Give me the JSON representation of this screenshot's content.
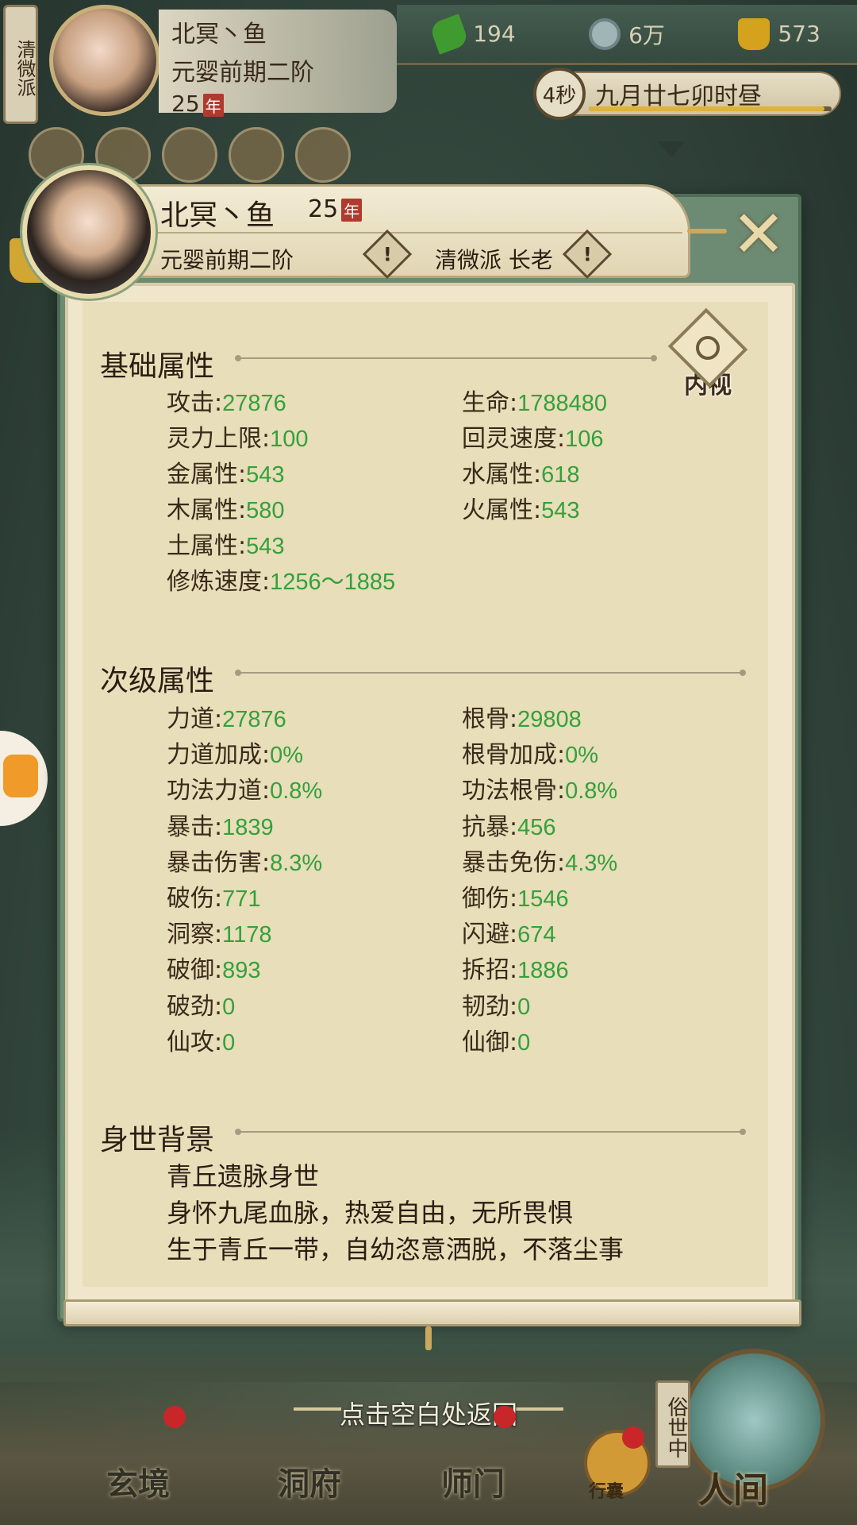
{
  "top_hud": {
    "sect_vertical": "清微派",
    "name": "北冥丶鱼",
    "realm": "元婴前期二阶",
    "age": "25",
    "year_glyph": "年",
    "resources": [
      {
        "icon": "jade-icon",
        "value": "194"
      },
      {
        "icon": "coin-icon",
        "value": "6万"
      },
      {
        "icon": "gold-ingot-icon",
        "value": "573"
      }
    ],
    "timer": {
      "seconds": "4秒",
      "date": "九月廿七卯时昼",
      "progress": 0.97
    }
  },
  "profile": {
    "name": "北冥丶鱼",
    "age": "25",
    "year_glyph": "年",
    "realm": "元婴前期二阶",
    "sect_role": "清微派 长老",
    "warn_glyph": "!",
    "close_glyph": "✕",
    "inner_view_label": "内视"
  },
  "basic": {
    "title": "基础属性",
    "stats": [
      {
        "label": "攻击",
        "value": "27876"
      },
      {
        "label": "生命",
        "value": "1788480"
      },
      {
        "label": "灵力上限",
        "value": "100"
      },
      {
        "label": "回灵速度",
        "value": "106"
      },
      {
        "label": "金属性",
        "value": "543"
      },
      {
        "label": "水属性",
        "value": "618"
      },
      {
        "label": "木属性",
        "value": "580"
      },
      {
        "label": "火属性",
        "value": "543"
      },
      {
        "label": "土属性",
        "value": "543"
      },
      {
        "label": "修炼速度",
        "value": "1256～1885"
      }
    ]
  },
  "secondary": {
    "title": "次级属性",
    "stats": [
      {
        "label": "力道",
        "value": "27876"
      },
      {
        "label": "根骨",
        "value": "29808"
      },
      {
        "label": "力道加成",
        "value": "0%"
      },
      {
        "label": "根骨加成",
        "value": "0%"
      },
      {
        "label": "功法力道",
        "value": "0.8%"
      },
      {
        "label": "功法根骨",
        "value": "0.8%"
      },
      {
        "label": "暴击",
        "value": "1839"
      },
      {
        "label": "抗暴",
        "value": "456"
      },
      {
        "label": "暴击伤害",
        "value": "8.3%"
      },
      {
        "label": "暴击免伤",
        "value": "4.3%"
      },
      {
        "label": "破伤",
        "value": "771"
      },
      {
        "label": "御伤",
        "value": "1546"
      },
      {
        "label": "洞察",
        "value": "1178"
      },
      {
        "label": "闪避",
        "value": "674"
      },
      {
        "label": "破御",
        "value": "893"
      },
      {
        "label": "拆招",
        "value": "1886"
      },
      {
        "label": "破劲",
        "value": "0"
      },
      {
        "label": "韧劲",
        "value": "0"
      },
      {
        "label": "仙攻",
        "value": "0"
      },
      {
        "label": "仙御",
        "value": "0"
      }
    ]
  },
  "background": {
    "title": "身世背景",
    "lines": [
      "青丘遗脉身世",
      "身怀九尾血脉，热爱自由，无所畏惧",
      "生于青丘一带，自幼恣意洒脱，不落尘事"
    ]
  },
  "bottom": {
    "hint": "点击空白处返回",
    "nav": [
      "玄境",
      "洞府",
      "师门"
    ],
    "bag_label": "行囊",
    "world_tag": "俗世中",
    "world_label": "人间"
  }
}
